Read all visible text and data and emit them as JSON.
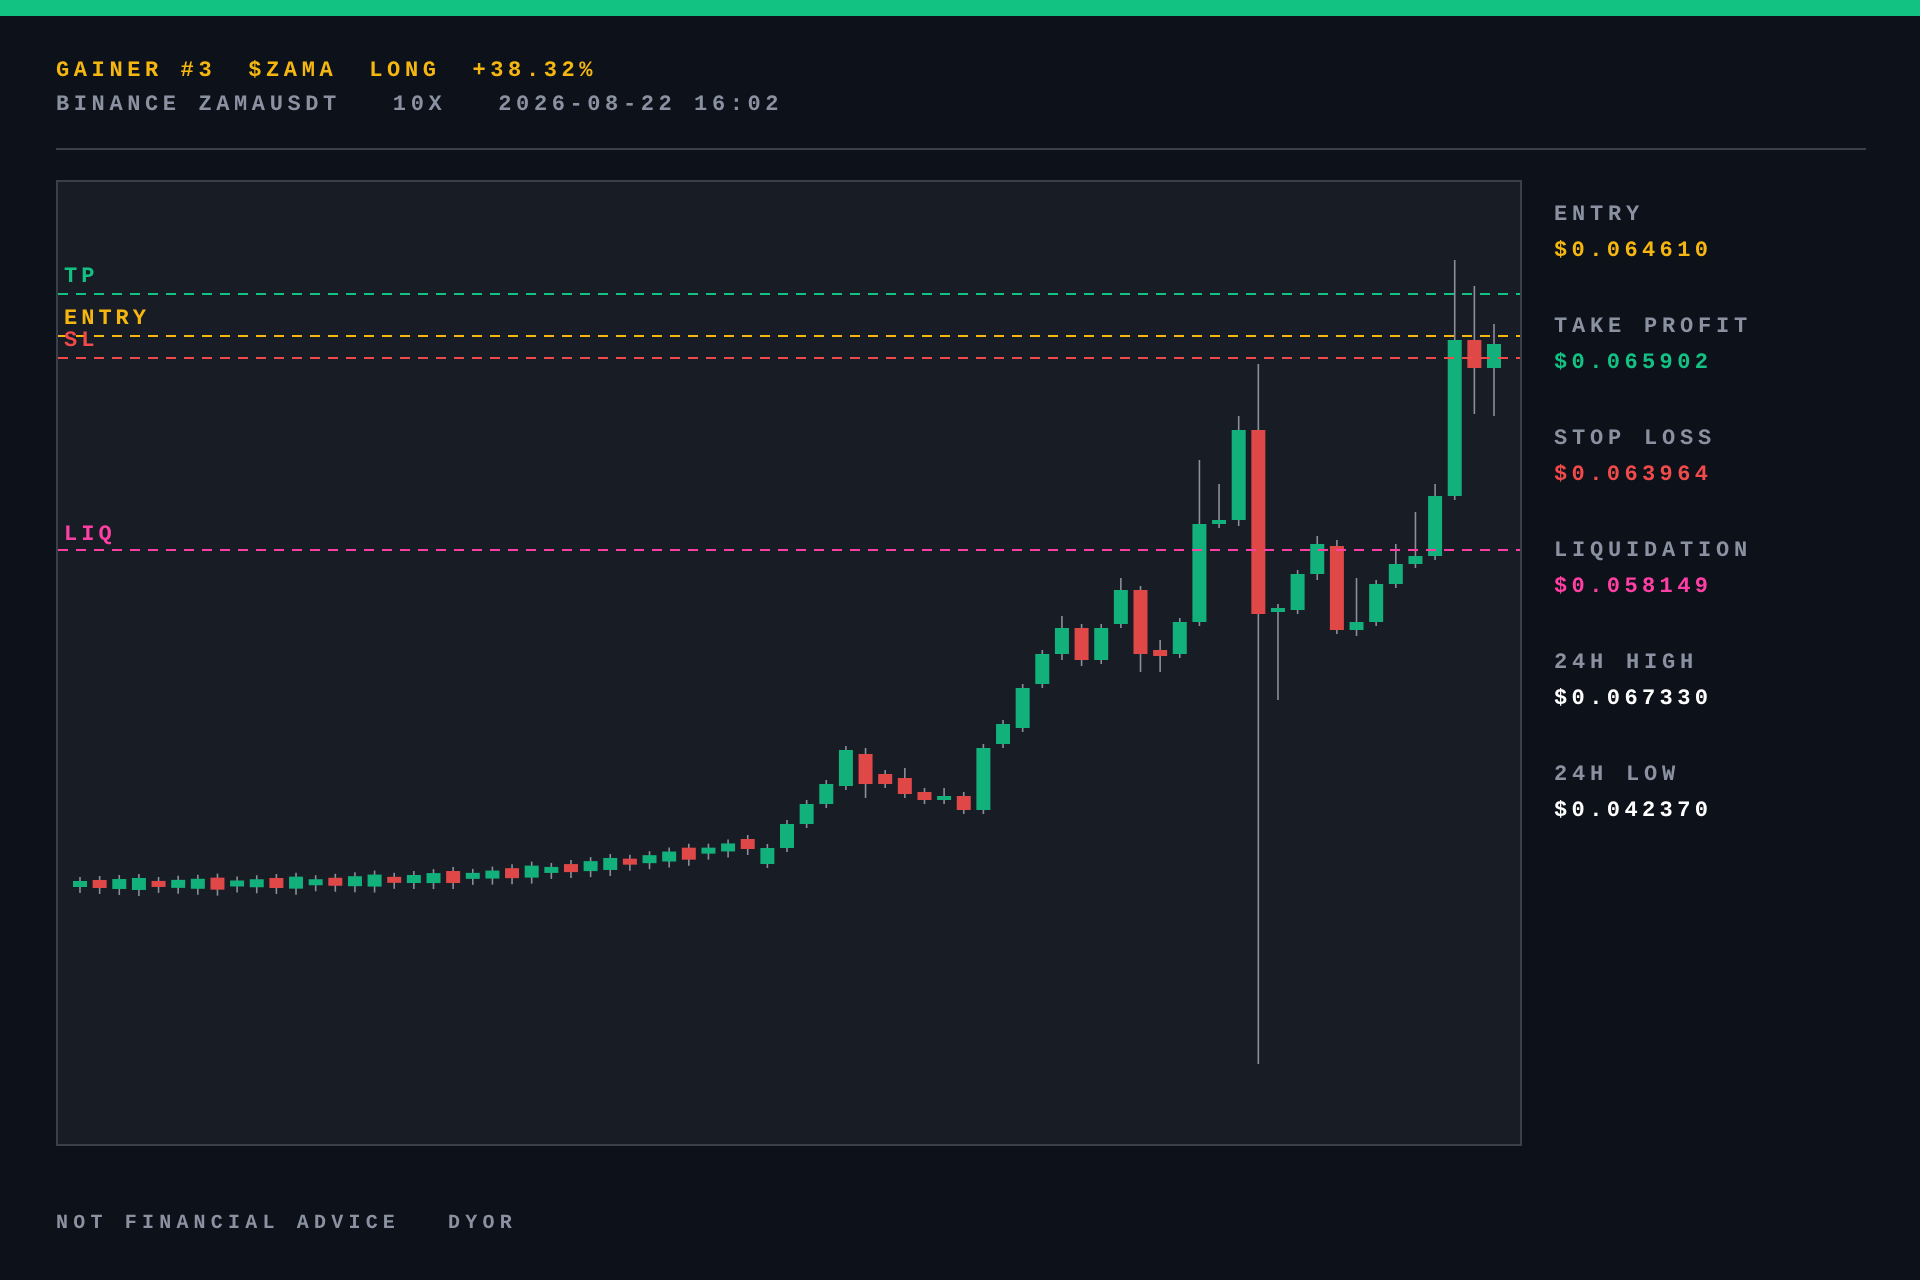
{
  "header": {
    "title_parts": [
      "GAINER #3",
      "$ZAMA",
      "LONG",
      "+38.32%"
    ],
    "subtitle_parts": [
      "BINANCE ZAMAUSDT",
      "10X",
      "2026-08-22 16:02"
    ]
  },
  "chart": {
    "levels": [
      {
        "label": "TP",
        "color": "#12c283"
      },
      {
        "label": "ENTRY",
        "color": "#f5b70f"
      },
      {
        "label": "SL",
        "color": "#f04a4a"
      },
      {
        "label": "LIQ",
        "color": "#ff3fa4"
      }
    ]
  },
  "stats": [
    {
      "label": "ENTRY",
      "value": "$0.064610",
      "color": "#f5b70f"
    },
    {
      "label": "TAKE PROFIT",
      "value": "$0.065902",
      "color": "#12c283"
    },
    {
      "label": "STOP LOSS",
      "value": "$0.063964",
      "color": "#f04a4a"
    },
    {
      "label": "LIQUIDATION",
      "value": "$0.058149",
      "color": "#ff3fa4"
    },
    {
      "label": "24H HIGH",
      "value": "$0.067330",
      "color": "#ffffff"
    },
    {
      "label": "24H LOW",
      "value": "$0.042370",
      "color": "#ffffff"
    }
  ],
  "footer": [
    "NOT FINANCIAL ADVICE",
    "DYOR"
  ]
}
